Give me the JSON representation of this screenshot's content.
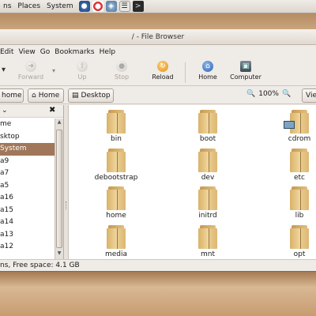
{
  "top_panel": {
    "menus": [
      "ns",
      "Places",
      "System"
    ],
    "icons": [
      "browser-icon",
      "help-icon",
      "network-icon",
      "notes-icon",
      "terminal-icon"
    ]
  },
  "window": {
    "title": "/ - File Browser",
    "menubar": [
      "Edit",
      "View",
      "Go",
      "Bookmarks",
      "Help"
    ],
    "toolbar": {
      "forward": "Forward",
      "up": "Up",
      "stop": "Stop",
      "reload": "Reload",
      "home": "Home",
      "computer": "Computer"
    },
    "location": {
      "crumbs": [
        "home",
        "Home",
        "Desktop"
      ],
      "zoom": "100%",
      "view_button": "Vie"
    },
    "sidepane": {
      "items": [
        "me",
        "sktop",
        " System",
        "a9",
        "a7",
        "a5",
        "a16",
        "a15",
        "a14",
        "a13",
        "a12"
      ],
      "selected_index": 2
    },
    "files": [
      "bin",
      "boot",
      "cdrom",
      "debootstrap",
      "dev",
      "etc",
      "home",
      "initrd",
      "lib",
      "media",
      "mnt",
      "opt"
    ],
    "status": "ns, Free space: 4.1 GB"
  }
}
